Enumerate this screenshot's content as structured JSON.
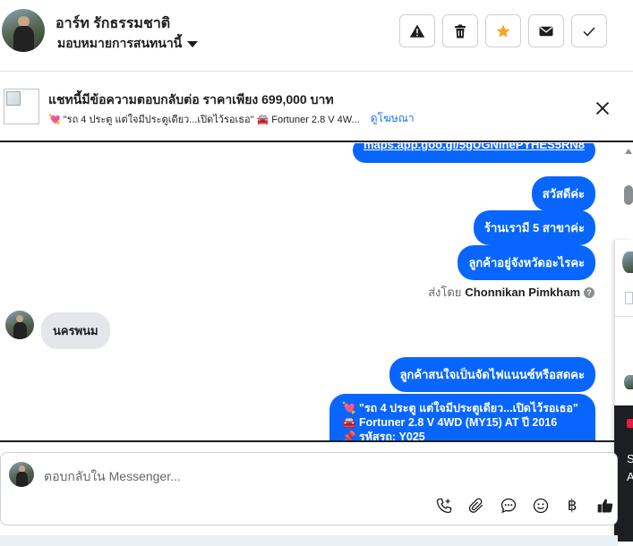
{
  "header": {
    "name": "อาร์ท รักธรรมชาติ",
    "assign_label": "มอบหมายการสนทนานี้",
    "buttons": [
      {
        "icon": "warning-icon"
      },
      {
        "icon": "trash-icon"
      },
      {
        "icon": "star-icon",
        "color": "#f5a623"
      },
      {
        "icon": "mail-icon"
      },
      {
        "icon": "check-icon"
      }
    ]
  },
  "ad_banner": {
    "title": "แชทนี้มีข้อความตอบกลับต่อ ราคาเพียง 699,000 บาท",
    "sub_text": "💘 \"รถ 4 ประตู แต่ใจมีประตูเดียว...เปิดไว้รอเธอ\" 🚘 Fortuner 2.8 V 4W...",
    "link": "ดูโฆษณา"
  },
  "messages": {
    "link_partial": "maps.app.goo.gl/5gUGNinePYHES5RN8",
    "m1": "สวัสดีค่ะ",
    "m2": "ร้านเรามี 5 สาขาค่ะ",
    "m3": "ลูกค้าอยู่จังหวัดอะไรคะ",
    "sent_by_prefix": "ส่งโดย",
    "sent_by_name": "Chonnikan Pimkham",
    "incoming": "นครพนม",
    "m4": "ลูกค้าสนใจเป็นจัดไฟแนนซ์หรือสดคะ",
    "m5_lines": [
      "💘 \"รถ 4 ประตู แต่ใจมีประตูเดียว...เปิดไว้รอเธอ\"",
      "🚘 Fortuner 2.8 V 4WD (MY15) AT ปี 2016",
      "📌 รหัสรถ: Y025"
    ]
  },
  "composer": {
    "placeholder": "ตอบกลับใน Messenger...",
    "tools": [
      "call-add-icon",
      "attachment-icon",
      "chat-bubble-icon",
      "emoji-icon",
      "baht-icon",
      "thumbs-up-icon"
    ],
    "baht_symbol": "฿"
  },
  "side_panel": {
    "line1": "S",
    "line2": "A"
  },
  "colors": {
    "accent": "#0866ff",
    "star": "#f5a623"
  }
}
